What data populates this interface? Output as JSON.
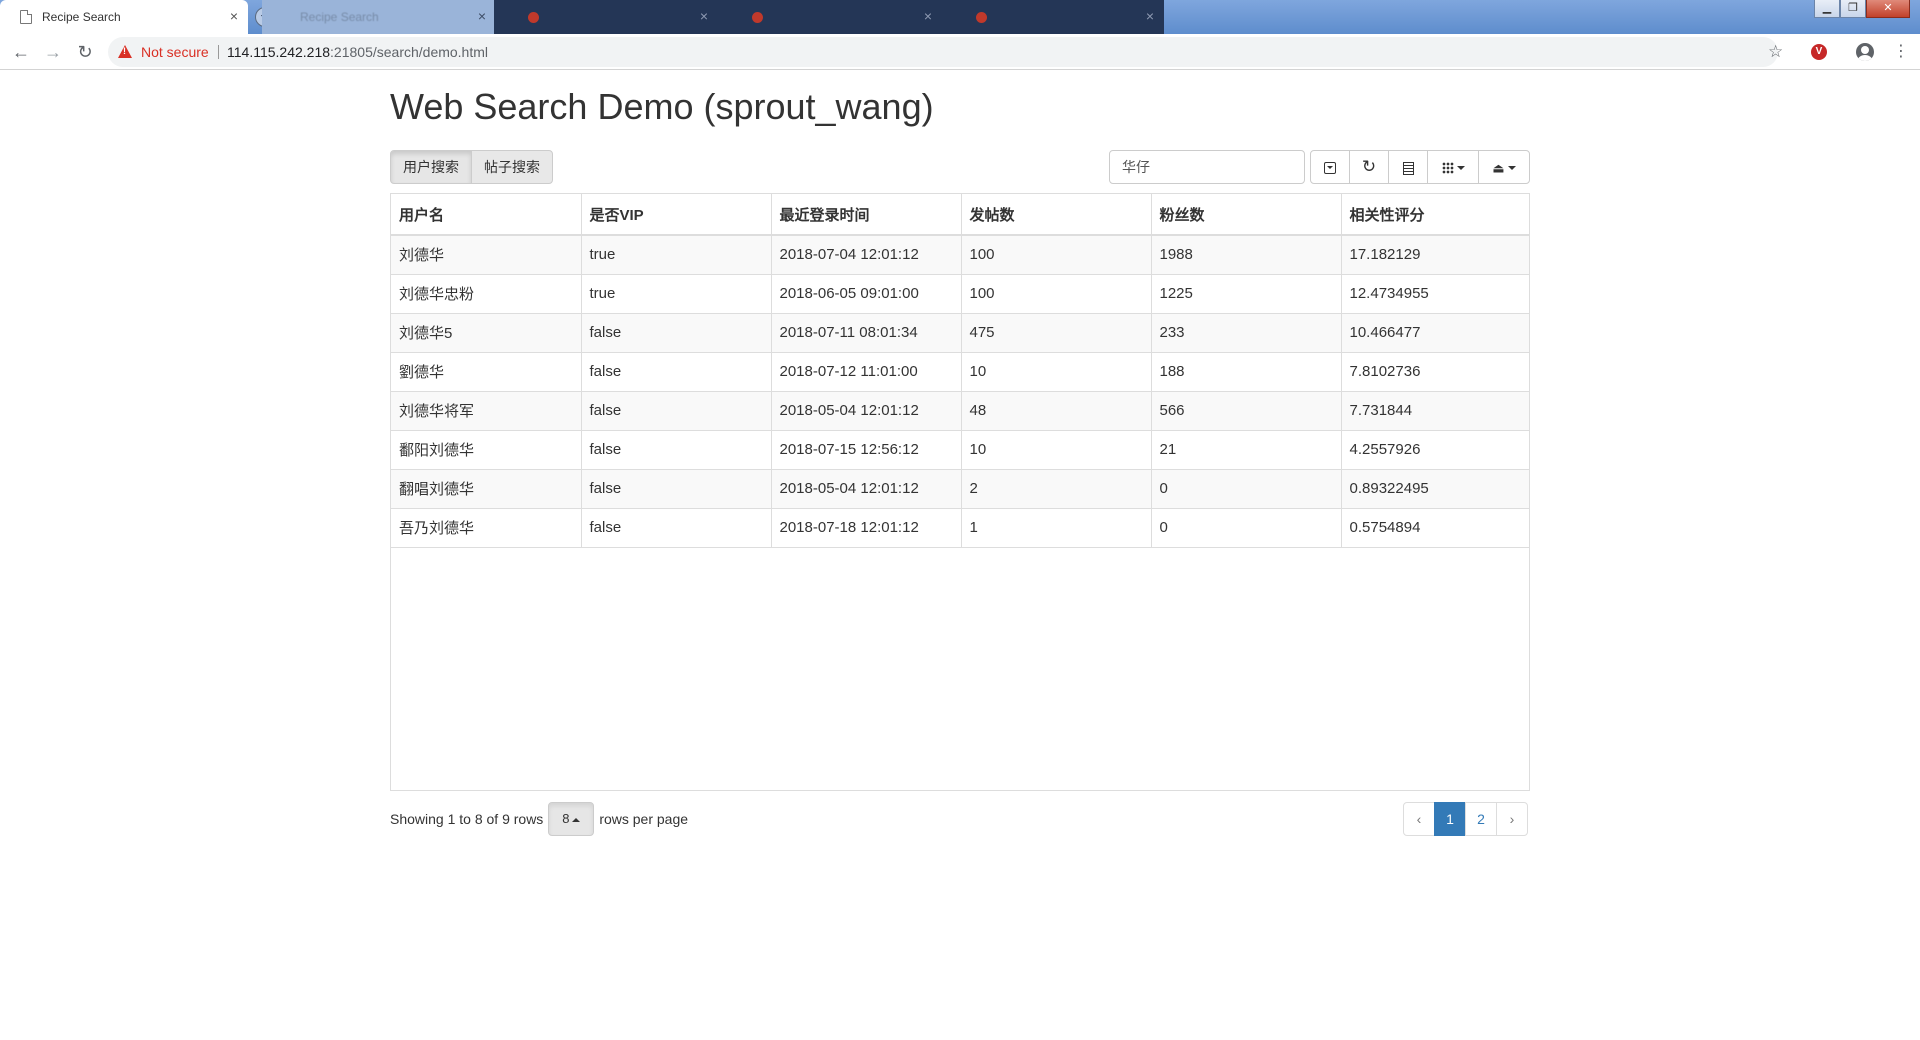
{
  "browser": {
    "tabs": [
      {
        "title": "Recipe Search",
        "active": true
      },
      {
        "title": "Recipe Search",
        "active": false
      },
      {
        "title": "",
        "active": false
      },
      {
        "title": "",
        "active": false
      },
      {
        "title": "",
        "active": false
      }
    ],
    "security_label": "Not secure",
    "url_host": "114.115.242.218",
    "url_rest": ":21805/search/demo.html",
    "close_glyph": "×",
    "new_tab_glyph": "+"
  },
  "page": {
    "title": "Web Search Demo (sprout_wang)"
  },
  "search_tabs": {
    "user_search": "用户搜索",
    "post_search": "帖子搜索"
  },
  "search": {
    "value": "华仔"
  },
  "toolbar": {
    "icons": [
      "toggle-icon",
      "refresh-icon",
      "list-icon",
      "columns-icon",
      "export-icon"
    ]
  },
  "table": {
    "columns": [
      "用户名",
      "是否VIP",
      "最近登录时间",
      "发帖数",
      "粉丝数",
      "相关性评分"
    ],
    "rows": [
      [
        "刘德华",
        "true",
        "2018-07-04 12:01:12",
        "100",
        "1988",
        "17.182129"
      ],
      [
        "刘德华忠粉",
        "true",
        "2018-06-05 09:01:00",
        "100",
        "1225",
        "12.4734955"
      ],
      [
        "刘德华5",
        "false",
        "2018-07-11 08:01:34",
        "475",
        "233",
        "10.466477"
      ],
      [
        "劉德华",
        "false",
        "2018-07-12 11:01:00",
        "10",
        "188",
        "7.8102736"
      ],
      [
        "刘德华将军",
        "false",
        "2018-05-04 12:01:12",
        "48",
        "566",
        "7.731844"
      ],
      [
        "鄱阳刘德华",
        "false",
        "2018-07-15 12:56:12",
        "10",
        "21",
        "4.2557926"
      ],
      [
        "翻唱刘德华",
        "false",
        "2018-05-04 12:01:12",
        "2",
        "0",
        "0.89322495"
      ],
      [
        "吾乃刘德华",
        "false",
        "2018-07-18 12:01:12",
        "1",
        "0",
        "0.5754894"
      ]
    ]
  },
  "pagination": {
    "showing_text": "Showing 1 to 8 of 9 rows",
    "page_size": "8",
    "rows_per_page_text": "rows per page",
    "prev": "‹",
    "pages": [
      "1",
      "2"
    ],
    "next": "›",
    "active_page": "1"
  },
  "colors": {
    "accent": "#337ab7",
    "warning": "#d93025"
  }
}
